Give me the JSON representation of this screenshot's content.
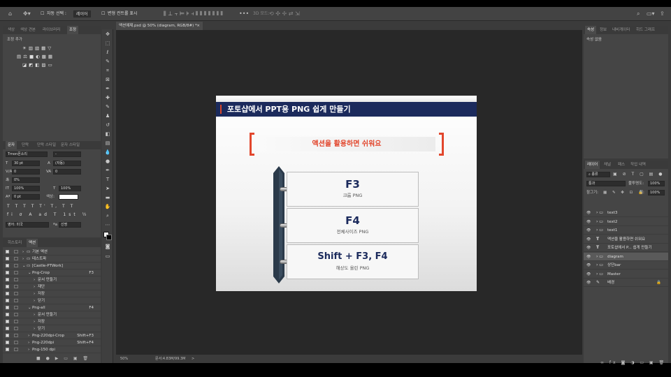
{
  "options_bar": {
    "auto_select_label": "자동 선택 :",
    "auto_select_target": "레이어",
    "show_transform_label": "변형 컨트롤 표시",
    "mode_3d_label": "3D 모드:"
  },
  "left_top_panel": {
    "tabs": [
      "색상",
      "색상 견본",
      "라이브러리",
      "조정"
    ],
    "active_tab": "조정",
    "add_adjustment_label": "조정 추가"
  },
  "character_panel": {
    "tabs": [
      "문자",
      "단락",
      "단락 스타일",
      "문자 스타일"
    ],
    "font_family": "Tmon몬소리",
    "font_style": "-",
    "font_size": "30 pt",
    "leading": "(자동)",
    "kerning": "0",
    "tracking": "0",
    "tsume": "0%",
    "vertical_scale": "100%",
    "horizontal_scale": "100%",
    "baseline_shift": "0 pt",
    "color_label": "색상:",
    "language": "영어: 미국",
    "antialias": "선명"
  },
  "actions_panel": {
    "tabs": [
      "히스토리",
      "액션"
    ],
    "active_tab": "액션",
    "rows": [
      {
        "label": "기본 액션",
        "key": "",
        "indent": 0,
        "type": "folder"
      },
      {
        "label": "테스트파",
        "key": "",
        "indent": 0,
        "type": "folder"
      },
      {
        "label": "[Castle-PTWork]",
        "key": "",
        "indent": 0,
        "type": "folder-open"
      },
      {
        "label": "Png-Crop",
        "key": "F3",
        "indent": 1,
        "type": "action-open"
      },
      {
        "label": "문서 만들기",
        "key": "",
        "indent": 2,
        "type": "step"
      },
      {
        "label": "재단",
        "key": "",
        "indent": 2,
        "type": "step"
      },
      {
        "label": "저장",
        "key": "",
        "indent": 2,
        "type": "step"
      },
      {
        "label": "닫기",
        "key": "",
        "indent": 2,
        "type": "step"
      },
      {
        "label": "Png-all",
        "key": "F4",
        "indent": 1,
        "type": "action-open"
      },
      {
        "label": "문서 만들기",
        "key": "",
        "indent": 2,
        "type": "step"
      },
      {
        "label": "저장",
        "key": "",
        "indent": 2,
        "type": "step"
      },
      {
        "label": "닫기",
        "key": "",
        "indent": 2,
        "type": "step"
      },
      {
        "label": "Png-220dpi-Crop",
        "key": "Shift+F3",
        "indent": 1,
        "type": "action"
      },
      {
        "label": "Png-220dpi",
        "key": "Shift+F4",
        "indent": 1,
        "type": "action"
      },
      {
        "label": "Png-150 dpi",
        "key": "",
        "indent": 1,
        "type": "action"
      }
    ]
  },
  "document": {
    "tab_title": "액션예제.psd @ 50% (diagram, RGB/8#) *",
    "zoom": "50%",
    "doc_info": "문서:4.83M/99.3M"
  },
  "slide": {
    "title": "포토샵에서 PPT용 PNG 쉽게 만들기",
    "subtitle": "액션을 활용하면 쉬워요",
    "cards": [
      {
        "title": "F3",
        "desc": "크롭 PNG"
      },
      {
        "title": "F4",
        "desc": "전체사이즈 PNG"
      },
      {
        "title": "Shift + F3, F4",
        "desc": "해상도 올린 PNG"
      }
    ],
    "colors": {
      "navy": "#1b2a5c",
      "accent": "#e2462c",
      "spine": "#2b3a4a"
    }
  },
  "properties_panel": {
    "tabs": [
      "속성",
      "정보",
      "내비게이터",
      "히드 그래프"
    ],
    "empty_label": "속성 없음"
  },
  "layers_panel": {
    "tabs": [
      "레이어",
      "채널",
      "패스",
      "작업 내역"
    ],
    "filter_kind": "종류",
    "blend_mode": "통과",
    "opacity_label": "불투명도:",
    "opacity": "100%",
    "lock_label": "잠그기:",
    "fill_label": "칠:",
    "fill": "100%",
    "layers": [
      {
        "name": "text3",
        "kind": "folder",
        "selected": false
      },
      {
        "name": "text2",
        "kind": "folder",
        "selected": false
      },
      {
        "name": "text1",
        "kind": "folder",
        "selected": false
      },
      {
        "name": "액션을 활용하면 쉬워요",
        "kind": "T",
        "selected": false
      },
      {
        "name": "포토샵에서 P... 쉽게 만들기",
        "kind": "T",
        "selected": false
      },
      {
        "name": "diagram",
        "kind": "folder",
        "selected": true
      },
      {
        "name": "상단bar",
        "kind": "folder",
        "selected": false
      },
      {
        "name": "Master",
        "kind": "folder",
        "selected": false
      },
      {
        "name": "배경",
        "kind": "bg",
        "selected": false
      }
    ]
  }
}
